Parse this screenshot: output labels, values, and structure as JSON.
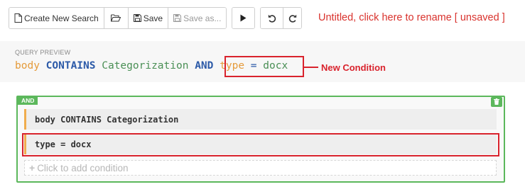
{
  "toolbar": {
    "create_new_search": "Create New Search",
    "save": "Save",
    "save_as": "Save as...",
    "icons": {
      "new": "new-document-icon",
      "open": "folder-open-icon",
      "save": "floppy-disk-icon",
      "save_as": "floppy-disk-icon",
      "run": "play-icon",
      "undo": "undo-icon",
      "redo": "redo-icon"
    }
  },
  "search_title": "Untitled, click here to rename [ unsaved ]",
  "preview": {
    "label": "QUERY PREVIEW",
    "field1": "body",
    "op1": "CONTAINS",
    "value1": "Categorization",
    "conj": "AND",
    "field2": "type",
    "eq": "=",
    "value2": "docx"
  },
  "callout": "New Condition",
  "group": {
    "operator": "AND",
    "conditions": [
      "body CONTAINS Categorization",
      "type = docx"
    ],
    "add_placeholder": "Click to add condition"
  },
  "colors": {
    "accent_red": "#d9232d",
    "group_green": "#5cb85c",
    "field_orange": "#e59b3b",
    "operator_blue": "#2c5aa8",
    "value_green": "#4a8f55"
  }
}
